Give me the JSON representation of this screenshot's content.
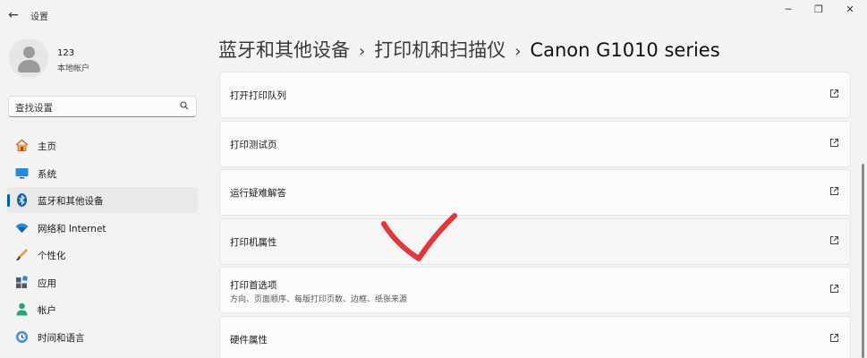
{
  "window": {
    "title": "设置",
    "back_glyph": "←",
    "minimize_glyph": "─",
    "maximize_glyph": "❐",
    "close_glyph": "✕"
  },
  "user": {
    "name": "123",
    "account_type": "本地帐户"
  },
  "search": {
    "placeholder": "查找设置"
  },
  "nav": {
    "items": [
      {
        "label": "主页",
        "icon": "home-icon",
        "active": false
      },
      {
        "label": "系统",
        "icon": "monitor-icon",
        "active": false
      },
      {
        "label": "蓝牙和其他设备",
        "icon": "bluetooth-icon",
        "active": true
      },
      {
        "label": "网络和 Internet",
        "icon": "wifi-icon",
        "active": false
      },
      {
        "label": "个性化",
        "icon": "brush-icon",
        "active": false
      },
      {
        "label": "应用",
        "icon": "apps-icon",
        "active": false
      },
      {
        "label": "帐户",
        "icon": "account-icon",
        "active": false
      },
      {
        "label": "时间和语言",
        "icon": "globe-clock-icon",
        "active": false
      }
    ]
  },
  "breadcrumb": {
    "items": [
      "蓝牙和其他设备",
      "打印机和扫描仪",
      "Canon G1010 series"
    ],
    "separator": "›"
  },
  "settings": {
    "items": [
      {
        "label": "打开打印队列",
        "description": ""
      },
      {
        "label": "打印测试页",
        "description": ""
      },
      {
        "label": "运行疑难解答",
        "description": ""
      },
      {
        "label": "打印机属性",
        "description": ""
      },
      {
        "label": "打印首选项",
        "description": "方向、页面顺序、每版打印页数、边框、纸张来源"
      },
      {
        "label": "硬件属性",
        "description": ""
      }
    ]
  },
  "colors": {
    "accent": "#005fb8",
    "annotation_red": "#e0393a",
    "background": "#f3f3f3",
    "card": "#fbfbfb"
  }
}
